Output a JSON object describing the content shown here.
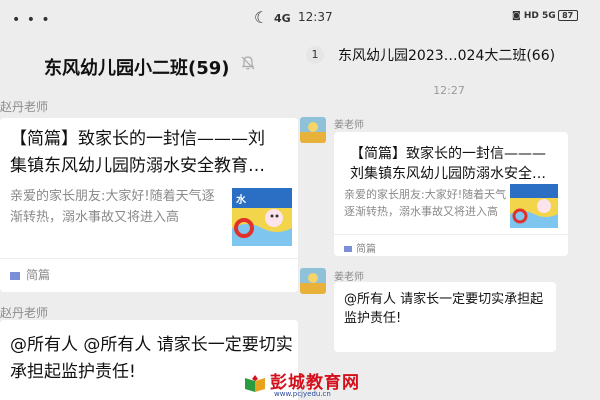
{
  "left": {
    "status": {
      "dots": "• • •",
      "moon_icon": "☾",
      "signal": "4G"
    },
    "title": "东风幼儿园小二班(59)",
    "bell_icon": "mute-bell-icon",
    "msg1": {
      "sender": "赵丹老师",
      "title_line1": "【简篇】致家长的一封信———刘",
      "title_line2": "集镇东风幼儿园防溺水安全教育…",
      "desc": "亲爱的家长朋友:大家好!随着天气逐渐转热，溺水事故又将进入高",
      "thumb_text": "水",
      "source": "简篇"
    },
    "msg2": {
      "sender": "赵丹老师",
      "text": "@所有人 @所有人 请家长一定要切实承担起监护责任!"
    }
  },
  "right": {
    "status": {
      "time": "12:37",
      "icons": "◙ HD 5G",
      "battery": "87"
    },
    "badge": "1",
    "title": "东风幼儿园2023…024大二班(66)",
    "timestamp": "12:27",
    "msg1": {
      "sender": "姜老师",
      "title_line1": "【简篇】致家长的一封信———",
      "title_line2": "刘集镇东风幼儿园防溺水安全…",
      "desc": "亲爱的家长朋友:大家好!随着天气逐渐转热，溺水事故又将进入高",
      "source": "简篇"
    },
    "msg2": {
      "sender": "姜老师",
      "text": "@所有人 请家长一定要切实承担起监护责任!"
    }
  },
  "watermark": {
    "text": "彭城教育网",
    "url": "www.pcjyedu.cn"
  },
  "colors": {
    "page_bg": "#ededed",
    "card_bg": "#ffffff",
    "muted": "#8a8a8a",
    "watermark_red": "#d4101c",
    "watermark_blue": "#2a4b9b"
  }
}
